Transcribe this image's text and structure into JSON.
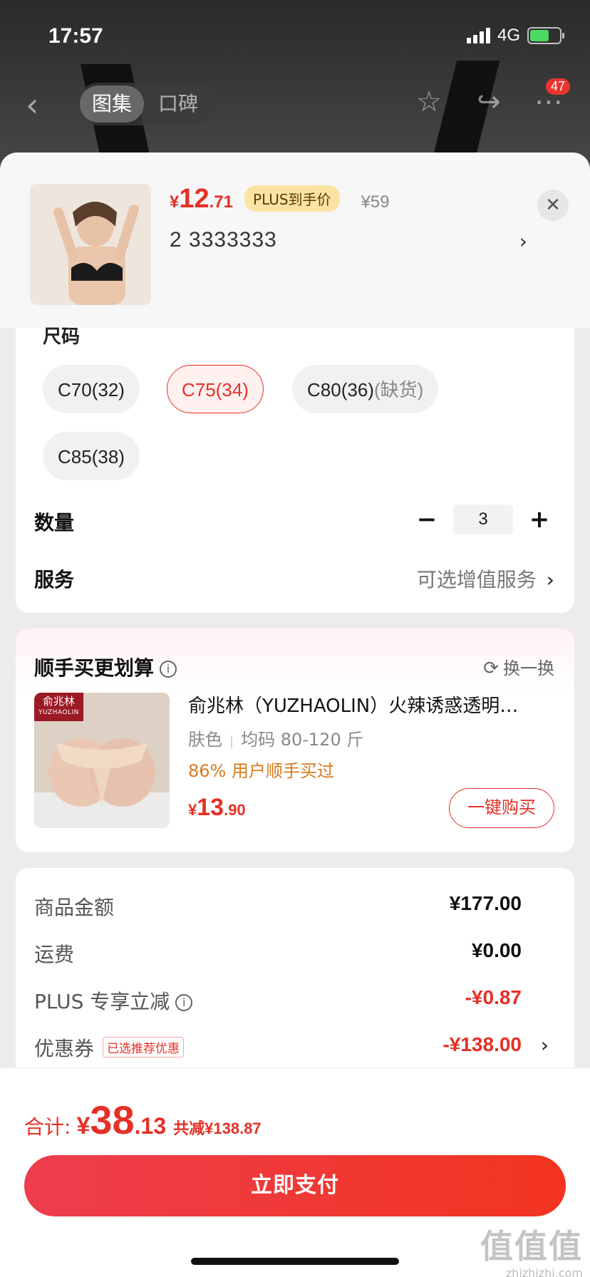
{
  "status_bar": {
    "time": "17:57",
    "network": "4G"
  },
  "nav": {
    "tabs": [
      "图集",
      "口碑"
    ],
    "badge_count": "47",
    "icons": [
      "back-icon",
      "star-icon",
      "share-icon",
      "more-icon"
    ]
  },
  "product": {
    "price_symbol": "¥",
    "price_int": "12",
    "price_dec": ".71",
    "plus_tag": "PLUS到手价",
    "original_price": "¥59",
    "variant": "2  3333333",
    "close_icon": "close-icon"
  },
  "size": {
    "title": "尺码",
    "options": [
      {
        "label": "C70(32)",
        "note": ""
      },
      {
        "label": "C75(34)",
        "note": ""
      },
      {
        "label": "C80(36)",
        "note": "(缺货)"
      },
      {
        "label": "C85(38)",
        "note": ""
      }
    ],
    "selected": "C75(34)"
  },
  "quantity": {
    "label": "数量",
    "value": "3",
    "minus": "−",
    "plus": "+"
  },
  "service": {
    "label": "服务",
    "value": "可选增值服务",
    "chevron": "›"
  },
  "recommend": {
    "title": "顺手买更划算",
    "swap_label": "换一换",
    "brand_cn": "俞兆林",
    "brand_en": "YUZHAOLIN",
    "name": "俞兆林（YUZHAOLIN）火辣诱惑透明…",
    "color": "肤色",
    "spec": "均码 80-120 斤",
    "hot": "86% 用户顺手买过",
    "price_symbol": "¥",
    "price_int": "13",
    "price_dec": ".90",
    "buy_label": "一键购买"
  },
  "fees": {
    "goods_label": "商品金额",
    "goods_value": "¥177.00",
    "shipping_label": "运费",
    "shipping_value": "¥0.00",
    "plus_label": "PLUS 专享立减",
    "plus_value": "-¥0.87",
    "coupon_label": "优惠券",
    "coupon_tag": "已选推荐优惠",
    "coupon_value": "-¥138.00"
  },
  "footer": {
    "total_label": "合计:",
    "total_symbol": "¥",
    "total_int": "38",
    "total_dec": ".13",
    "saved": "共减¥138.87",
    "pay_label": "立即支付"
  },
  "watermark": {
    "text": "值值值",
    "url": "zhizhizhi.com"
  },
  "colors": {
    "accent": "#e53027",
    "plus_gold": "#fbe4a3",
    "hot_orange": "#d97a1e"
  }
}
